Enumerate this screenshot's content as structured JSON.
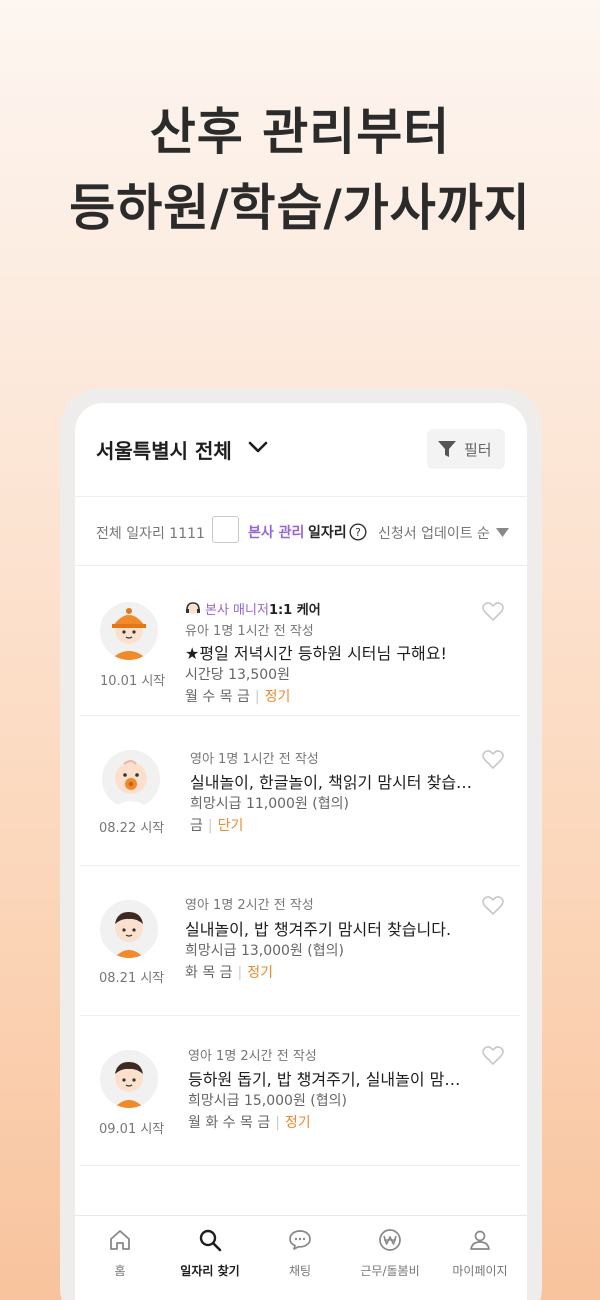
{
  "headline": {
    "line1": "산후 관리부터",
    "line2": "등하원/학습/가사까지"
  },
  "header": {
    "region": "서울특별시 전체",
    "filter_label": "필터",
    "icons": {
      "dropdown": "chevron-down-icon",
      "filter": "filter-funnel-icon"
    }
  },
  "subbar": {
    "total_label": "전체 일자리 1111",
    "hq_label": "본사 관리",
    "job_label": "일자리",
    "sort_label": "신청서 업데이트 순"
  },
  "jobs": [
    {
      "avatar": "child-orange-hat-avatar",
      "start": "10.01 시작",
      "badge_manager": "본사 매니저",
      "badge_care": "1:1 케어",
      "meta": "유아 1명  1시간 전 작성",
      "title": "★평일 저녁시간 등하원 시터님 구해요!",
      "wage": "시간당 13,500원",
      "days": "월 수 목 금",
      "term": "정기"
    },
    {
      "avatar": "baby-pacifier-avatar",
      "start": "08.22 시작",
      "meta": "영아 1명  1시간 전 작성",
      "title": "실내놀이, 한글놀이, 책읽기 맘시터 찾습니다.",
      "wage": "희망시급 11,000원 (협의)",
      "days": "금",
      "term": "단기"
    },
    {
      "avatar": "baby-boy-avatar",
      "start": "08.21 시작",
      "meta": "영아 1명  2시간 전 작성",
      "title": "실내놀이, 밥 챙겨주기 맘시터 찾습니다.",
      "wage": "희망시급 13,000원 (협의)",
      "days": "화 목 금",
      "term": "정기"
    },
    {
      "avatar": "baby-boy-avatar",
      "start": "09.01 시작",
      "meta": "영아 1명  2시간 전 작성",
      "title": "등하원 돕기, 밥 챙겨주기, 실내놀이 맘시터…",
      "wage": "희망시급 15,000원 (협의)",
      "days": "월 화 수 목 금",
      "term": "정기"
    }
  ],
  "nav": [
    {
      "label": "홈",
      "icon": "home-icon"
    },
    {
      "label": "일자리 찾기",
      "icon": "search-icon",
      "active": true
    },
    {
      "label": "채팅",
      "icon": "chat-bubble-icon"
    },
    {
      "label": "근무/돌봄비",
      "icon": "won-coin-icon"
    },
    {
      "label": "마이페이지",
      "icon": "person-icon"
    }
  ],
  "colors": {
    "accent_purple": "#9566d4",
    "accent_orange": "#f0892d",
    "background_top": "#fdf6f1",
    "background_bottom": "#f8c39d"
  }
}
